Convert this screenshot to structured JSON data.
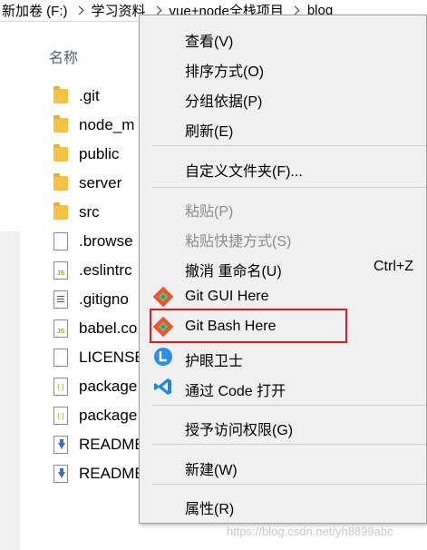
{
  "breadcrumb": [
    "新加卷 (F:)",
    "学习资料",
    "vue+node全栈项目",
    "blog"
  ],
  "file_list": {
    "column_header": "名称",
    "items": [
      {
        "name": ".git",
        "icon": "folder-icon"
      },
      {
        "name": "node_m",
        "icon": "folder-icon"
      },
      {
        "name": "public",
        "icon": "folder-icon"
      },
      {
        "name": "server",
        "icon": "folder-icon"
      },
      {
        "name": "src",
        "icon": "folder-icon"
      },
      {
        "name": ".browse",
        "icon": "file-icon"
      },
      {
        "name": ".eslintrc",
        "icon": "js-file-icon"
      },
      {
        "name": ".gitigno",
        "icon": "text-file-icon"
      },
      {
        "name": "babel.co",
        "icon": "js-file-icon"
      },
      {
        "name": "LICENSE",
        "icon": "file-icon"
      },
      {
        "name": "package",
        "icon": "json-file-icon"
      },
      {
        "name": "package",
        "icon": "json-file-icon"
      },
      {
        "name": "README",
        "icon": "readme-file-icon"
      },
      {
        "name": "README",
        "icon": "readme-file-icon"
      }
    ]
  },
  "context_menu": {
    "items": [
      {
        "label": "查看(V)"
      },
      {
        "label": "排序方式(O)"
      },
      {
        "label": "分组依据(P)"
      },
      {
        "label": "刷新(E)"
      },
      {
        "label": "自定义文件夹(F)..."
      },
      {
        "label": "粘贴(P)",
        "disabled": true
      },
      {
        "label": "粘贴快捷方式(S)",
        "disabled": true
      },
      {
        "label": "撤消 重命名(U)",
        "shortcut": "Ctrl+Z"
      },
      {
        "label": "Git GUI Here",
        "icon": "git-gui-icon"
      },
      {
        "label": "Git Bash Here",
        "icon": "git-bash-icon",
        "highlighted": true
      },
      {
        "label": "护眼卫士",
        "icon": "eye-guard-icon"
      },
      {
        "label": "通过 Code 打开",
        "icon": "vscode-icon"
      },
      {
        "label": "授予访问权限(G)"
      },
      {
        "label": "新建(W)"
      },
      {
        "label": "属性(R)"
      }
    ]
  },
  "colors": {
    "menu_background": "#f0f0f0",
    "highlight_border": "#e01b1b",
    "folder": "#f5c342",
    "disabled_text": "#8d8d8d"
  },
  "watermark": "https://blog.csdn.net/yh8899abc"
}
